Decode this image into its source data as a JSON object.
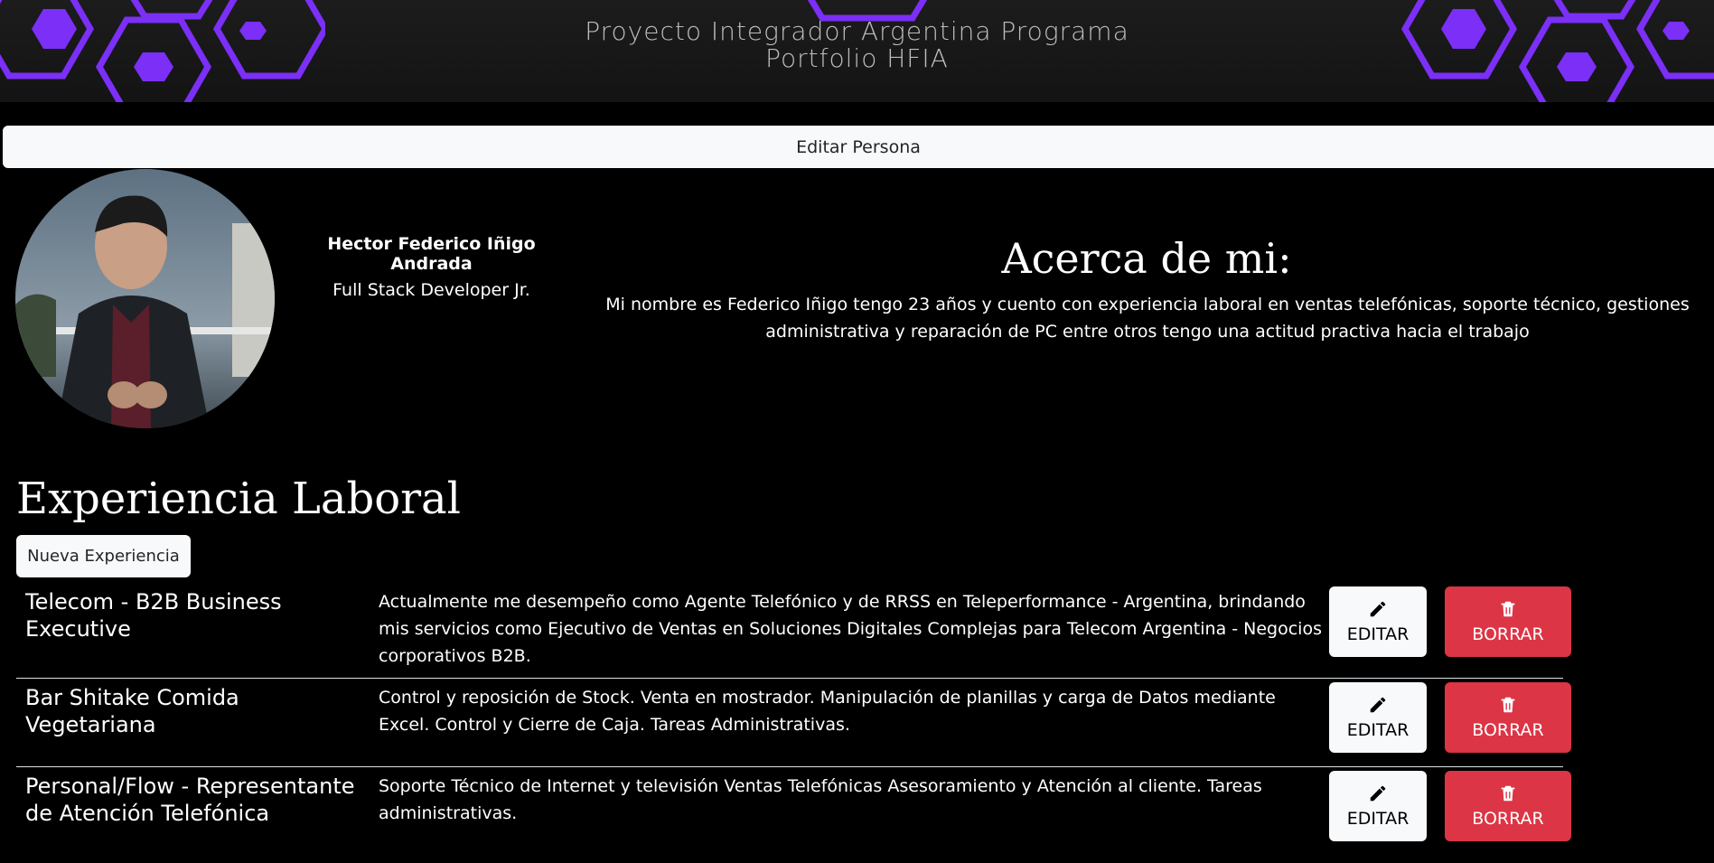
{
  "banner": {
    "title_line1": "Proyecto Integrador Argentina Programa",
    "title_line2": "Portfolio HFIA",
    "accent": "#7b2ff7"
  },
  "persona": {
    "edit_label": "Editar Persona",
    "name": "Hector Federico Iñigo Andrada",
    "role": "Full Stack Developer Jr.",
    "about_title": "Acerca de mi:",
    "about_text": "Mi nombre es Federico Iñigo tengo 23 años y cuento con experiencia laboral en ventas telefónicas, soporte técnico, gestiones administrativa y reparación de PC entre otros tengo una actitud practiva hacia el trabajo"
  },
  "experience": {
    "title": "Experiencia Laboral",
    "new_label": "Nueva Experiencia",
    "edit_label": "EDITAR",
    "delete_label": "BORRAR",
    "edit_icon": "pencil-icon",
    "delete_icon": "trash-icon",
    "delete_color": "#dc3545",
    "items": [
      {
        "role": "Telecom - B2B Business Executive",
        "description": "Actualmente me desempeño como Agente Telefónico y de RRSS en Teleperformance - Argentina, brindando mis servicios como Ejecutivo de Ventas en Soluciones Digitales Complejas para Telecom Argentina - Negocios corporativos B2B."
      },
      {
        "role": "Bar Shitake Comida Vegetariana",
        "description": "Control y reposición de Stock. Venta en mostrador. Manipulación de planillas y carga de Datos mediante Excel. Control y Cierre de Caja. Tareas Administrativas."
      },
      {
        "role": "Personal/Flow - Representante de Atención Telefónica",
        "description": "Soporte Técnico de Internet y televisión Ventas Telefónicas Asesoramiento y Atención al cliente. Tareas administrativas."
      }
    ]
  }
}
